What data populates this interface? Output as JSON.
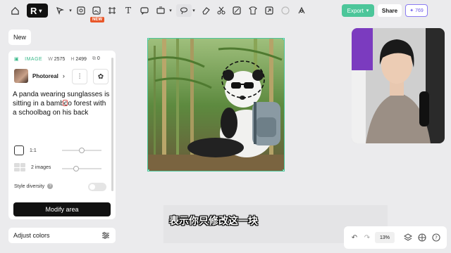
{
  "toolbar": {
    "logo_text": "R",
    "new_tag": "NEW",
    "export_label": "Export",
    "share_label": "Share",
    "credits": "769",
    "icons": [
      "home-icon",
      "select-icon",
      "image-icon",
      "ai-image-icon",
      "text-icon",
      "comment-icon",
      "expand-icon",
      "lasso-icon",
      "eraser-icon",
      "cut-icon",
      "remove-bg-icon",
      "shirt-icon",
      "upscale-icon",
      "color-icon",
      "style-icon"
    ]
  },
  "new_button": "New",
  "panel": {
    "header_label": "IMAGE",
    "w_label": "W",
    "w_value": "2575",
    "h_label": "H",
    "h_value": "2499",
    "count_value": "0",
    "model_name": "Photoreal",
    "prompt": "A panda wearing sunglasses is sitting in a bamboo forest with a schoolbag on his back",
    "ratio_label": "1:1",
    "images_label": "2 images",
    "style_diversity_label": "Style diversity",
    "modify_button": "Modify area",
    "ratio_slider_value": 0.5,
    "images_slider_value": 0.35
  },
  "adjust_colors_label": "Adjust colors",
  "subtitle_text": "表示你只修改这一块",
  "bottom_bar": {
    "zoom": "13%"
  },
  "colors": {
    "accent": "#4cc69a",
    "credits": "#6b58e8",
    "new_tag": "#e8572a"
  }
}
